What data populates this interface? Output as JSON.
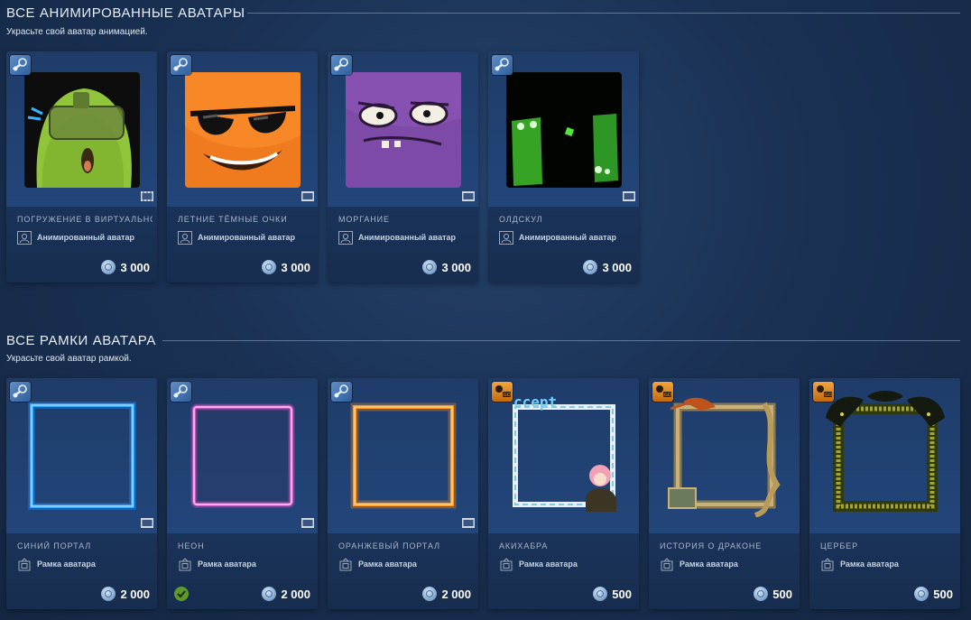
{
  "sections": [
    {
      "title": "ВСЕ АНИМИРОВАННЫЕ АВАТАРЫ",
      "subtitle": "Украсьте свой аватар анимацией.",
      "items": [
        {
          "name": "ПОГРУЖЕНИЕ В ВИРТУАЛЬНОС",
          "type": "Анимированный аватар",
          "price": "3 000",
          "badge": "steam-icon"
        },
        {
          "name": "ЛЕТНИЕ ТЁМНЫЕ ОЧКИ",
          "type": "Анимированный аватар",
          "price": "3 000",
          "badge": "steam-icon"
        },
        {
          "name": "МОРГАНИЕ",
          "type": "Анимированный аватар",
          "price": "3 000",
          "badge": "steam-icon"
        },
        {
          "name": "ОЛДСКУЛ",
          "type": "Анимированный аватар",
          "price": "3 000",
          "badge": "steam-icon"
        }
      ]
    },
    {
      "title": "ВСЕ РАМКИ АВАТАРА",
      "subtitle": "Украсьте свой аватар рамкой.",
      "items": [
        {
          "name": "СИНИЙ ПОРТАЛ",
          "type": "Рамка аватара",
          "price": "2 000",
          "badge": "steam-icon"
        },
        {
          "name": "НЕОН",
          "type": "Рамка аватара",
          "price": "2 000",
          "badge": "steam-icon",
          "owned": true
        },
        {
          "name": "ОРАНЖЕВЫЙ ПОРТАЛ",
          "type": "Рамка аватара",
          "price": "2 000",
          "badge": "steam-icon"
        },
        {
          "name": "АКИХАБРА",
          "type": "Рамка аватара",
          "price": "500",
          "badge": "csgo-icon",
          "art_text": "ccept"
        },
        {
          "name": "ИСТОРИЯ О ДРАКОНЕ",
          "type": "Рамка аватара",
          "price": "500",
          "badge": "csgo-icon"
        },
        {
          "name": "ЦЕРБЕР",
          "type": "Рамка аватара",
          "price": "500",
          "badge": "csgo-icon"
        }
      ]
    }
  ],
  "colors": {
    "background": "#1a3154",
    "card": "#1c355d",
    "owned_check": "#5c9a2c",
    "blue_portal": "#1e90ff",
    "neon": "#ff4fd8",
    "orange_portal": "#ff8c1a"
  }
}
